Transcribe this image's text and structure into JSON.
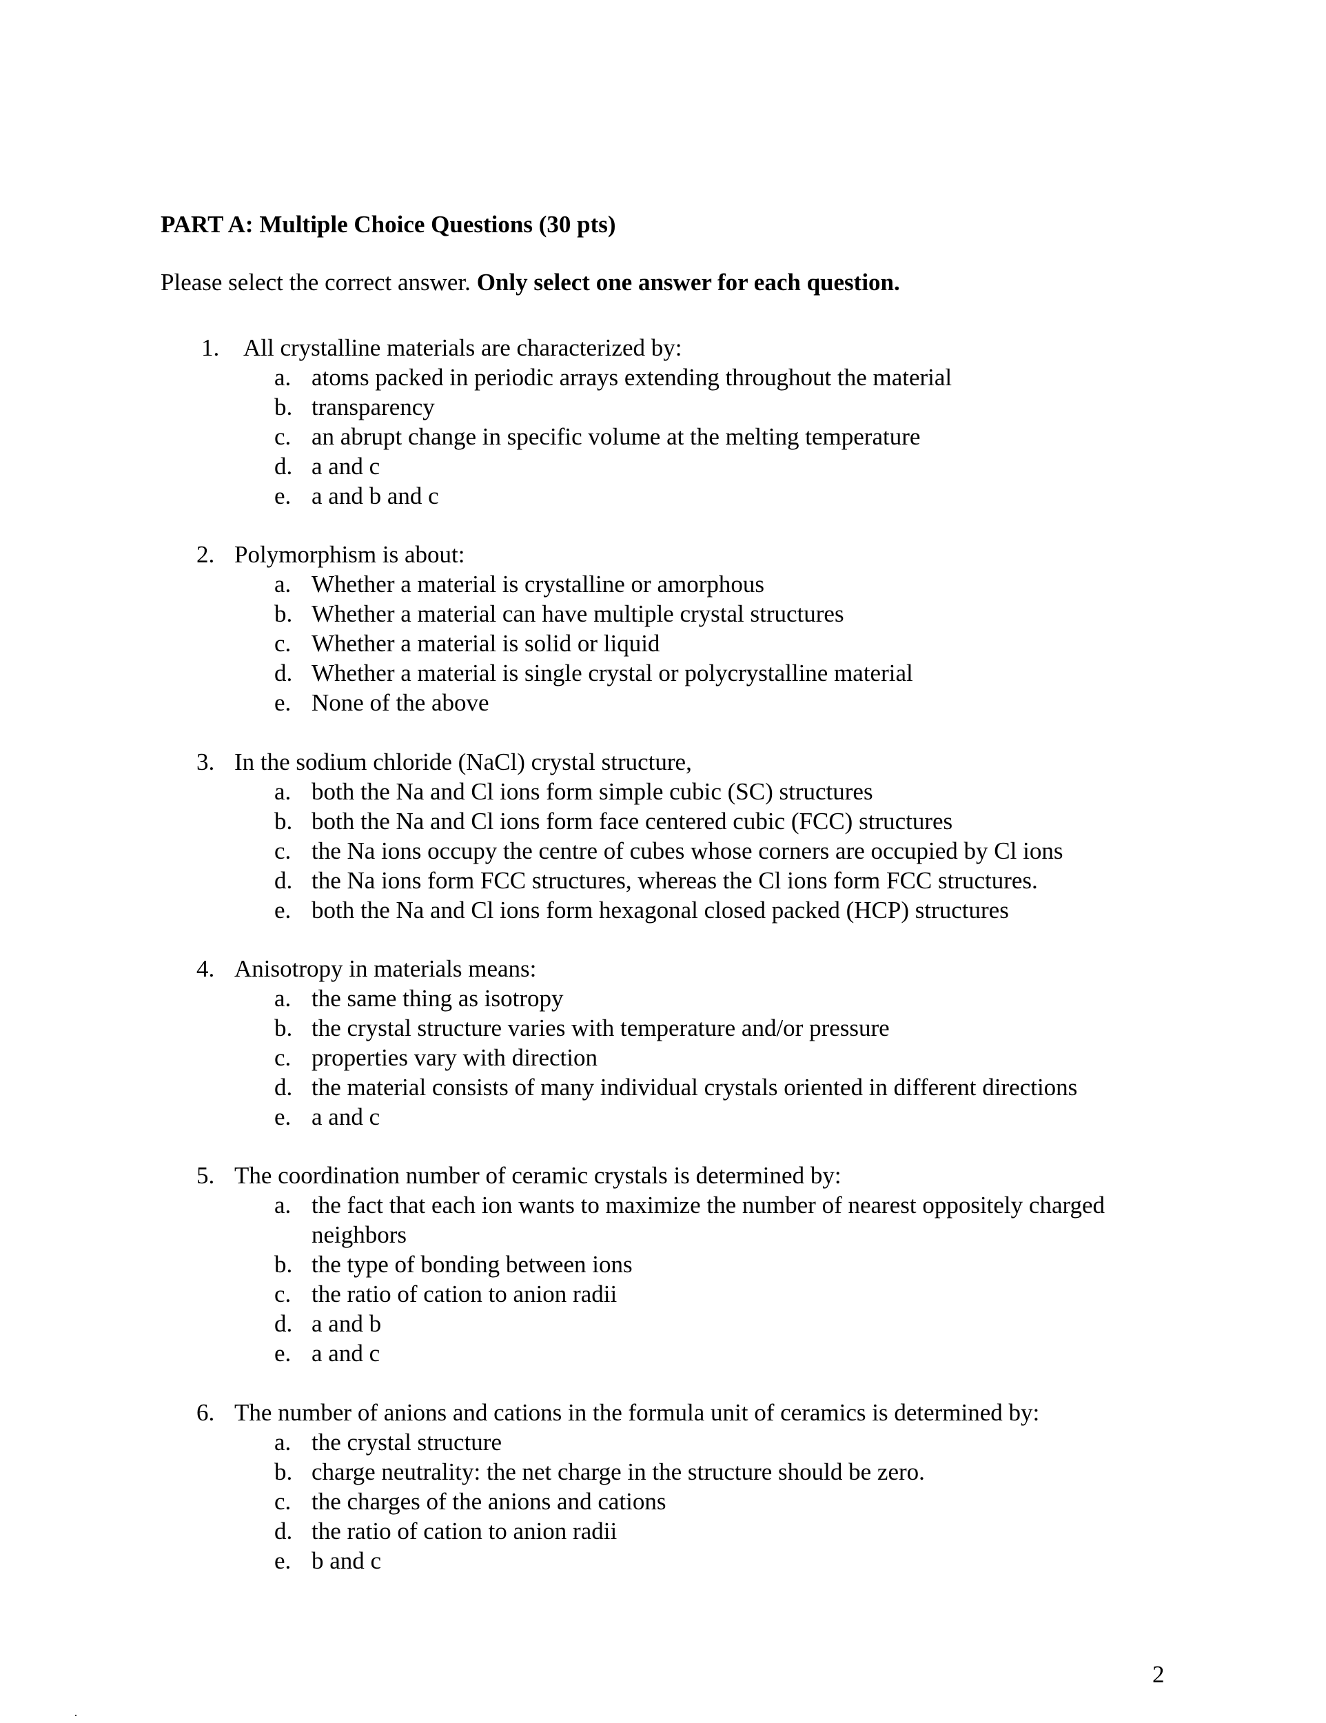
{
  "document": {
    "part_title": "PART A: Multiple Choice Questions (30 pts)",
    "instructions": {
      "plain": "Please select the correct answer. ",
      "bold": "Only select one answer for each question."
    },
    "page_number": "2"
  },
  "questions": [
    {
      "number": "1.",
      "text": "All crystalline materials are characterized by:",
      "options": [
        {
          "letter": "a.",
          "text": "atoms packed in periodic arrays extending throughout the material"
        },
        {
          "letter": "b.",
          "text": "transparency"
        },
        {
          "letter": "c.",
          "text": "an abrupt change in specific volume at the melting temperature"
        },
        {
          "letter": "d.",
          "text": "a and c"
        },
        {
          "letter": "e.",
          "text": "a and b and c"
        }
      ]
    },
    {
      "number": "2.",
      "text": "Polymorphism is about:",
      "options": [
        {
          "letter": "a.",
          "text": "Whether a material is crystalline or amorphous"
        },
        {
          "letter": "b.",
          "text": "Whether a material can have multiple crystal structures"
        },
        {
          "letter": "c.",
          "text": "Whether a material is solid or liquid"
        },
        {
          "letter": "d.",
          "text": "Whether a material is single crystal or polycrystalline material"
        },
        {
          "letter": "e.",
          "text": "None of the above"
        }
      ]
    },
    {
      "number": "3.",
      "text": "In the sodium chloride (NaCl) crystal structure,",
      "options": [
        {
          "letter": "a.",
          "text": "both the Na and Cl ions form simple cubic (SC) structures"
        },
        {
          "letter": "b.",
          "text": "both the Na and Cl ions form face centered cubic (FCC) structures"
        },
        {
          "letter": "c.",
          "text": "the Na ions occupy the centre of cubes whose corners are occupied by Cl ions"
        },
        {
          "letter": "d.",
          "text": "the Na ions form FCC structures, whereas the Cl ions form FCC structures."
        },
        {
          "letter": "e.",
          "text": "both the Na and Cl ions form hexagonal closed packed (HCP) structures"
        }
      ]
    },
    {
      "number": "4.",
      "text": "Anisotropy in materials means:",
      "options": [
        {
          "letter": "a.",
          "text": "the same thing as isotropy"
        },
        {
          "letter": "b.",
          "text": "the crystal structure varies with temperature and/or pressure"
        },
        {
          "letter": "c.",
          "text": "properties vary with direction"
        },
        {
          "letter": "d.",
          "text": "the material consists of many individual crystals oriented in different directions"
        },
        {
          "letter": "e.",
          "text": "a and c"
        }
      ]
    },
    {
      "number": "5.",
      "text": "The coordination number of ceramic crystals is determined by:",
      "options": [
        {
          "letter": "a.",
          "text": "the fact that each ion wants to maximize the number of nearest oppositely charged neighbors"
        },
        {
          "letter": "b.",
          "text": "the type of bonding between ions"
        },
        {
          "letter": "c.",
          "text": "the ratio of cation to anion radii"
        },
        {
          "letter": "d.",
          "text": "a and b"
        },
        {
          "letter": "e.",
          "text": "a and c"
        }
      ]
    },
    {
      "number": "6.",
      "text": "The number of anions and cations in the formula unit of ceramics is determined by:",
      "options": [
        {
          "letter": "a.",
          "text": "the crystal structure"
        },
        {
          "letter": "b.",
          "text": "charge neutrality: the net charge in the structure should be zero."
        },
        {
          "letter": "c.",
          "text": "the charges of the anions and cations"
        },
        {
          "letter": "d.",
          "text": "the ratio of cation to anion radii"
        },
        {
          "letter": "e.",
          "text": "b and c"
        }
      ]
    }
  ]
}
